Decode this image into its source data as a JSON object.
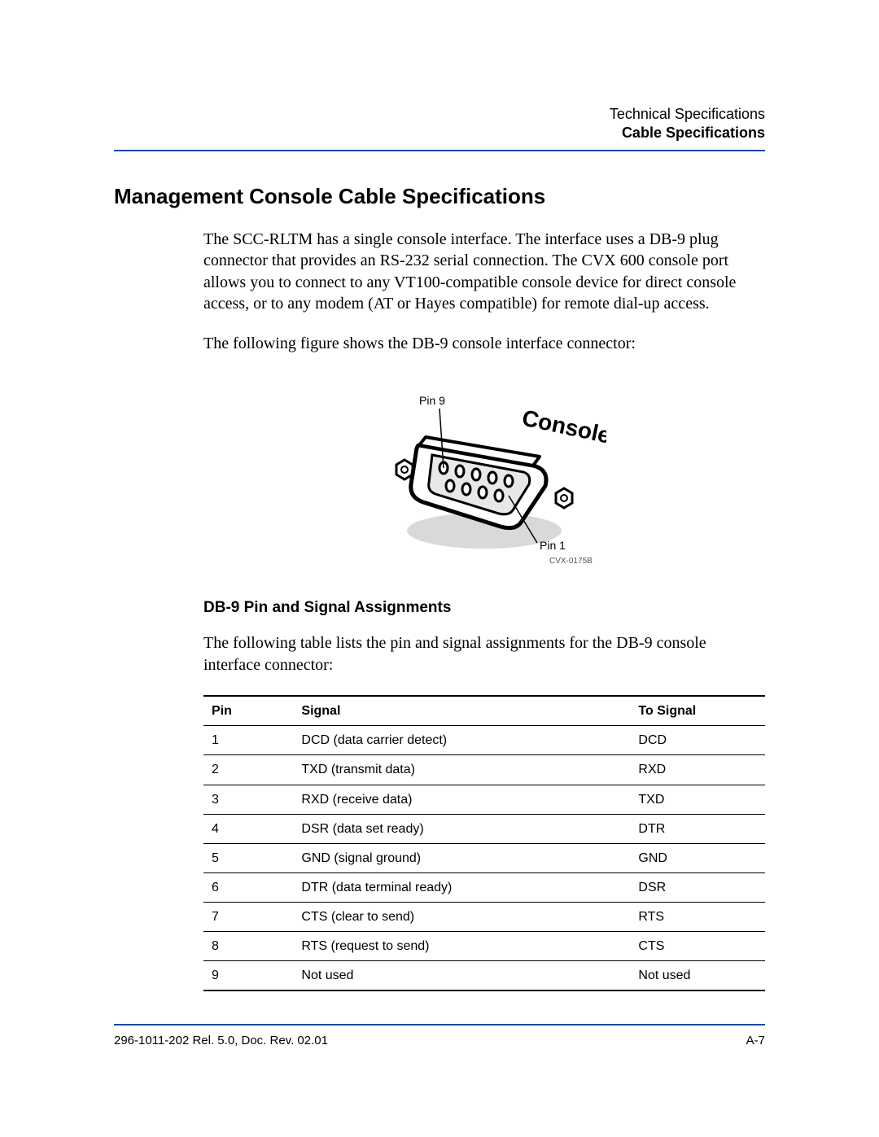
{
  "header": {
    "doc_section": "Technical Specifications",
    "subsection": "Cable Specifications"
  },
  "title": "Management Console Cable Specifications",
  "paragraphs": {
    "p1": "The SCC-RLTM has a single console interface. The interface uses a DB-9 plug connector that provides an RS-232 serial connection. The CVX 600 console port allows you to connect to any VT100-compatible console device for direct console access, or to any modem (AT or Hayes compatible) for remote dial-up access.",
    "p2": "The following figure shows the DB-9 console interface connector:"
  },
  "figure": {
    "label_top": "Pin 9",
    "label_main": "Console",
    "label_bottom": "Pin 1",
    "code": "CVX-0175B"
  },
  "subsection_title": "DB-9 Pin and Signal Assignments",
  "subsection_intro": "The following table lists the pin and signal assignments for the DB-9 console interface connector:",
  "table": {
    "headers": {
      "pin": "Pin",
      "signal": "Signal",
      "to_signal": "To Signal"
    },
    "rows": [
      {
        "pin": "1",
        "signal": "DCD (data carrier detect)",
        "to_signal": "DCD"
      },
      {
        "pin": "2",
        "signal": "TXD (transmit data)",
        "to_signal": "RXD"
      },
      {
        "pin": "3",
        "signal": "RXD (receive data)",
        "to_signal": "TXD"
      },
      {
        "pin": "4",
        "signal": "DSR (data set ready)",
        "to_signal": "DTR"
      },
      {
        "pin": "5",
        "signal": "GND (signal ground)",
        "to_signal": "GND"
      },
      {
        "pin": "6",
        "signal": "DTR (data terminal ready)",
        "to_signal": "DSR"
      },
      {
        "pin": "7",
        "signal": "CTS (clear to send)",
        "to_signal": "RTS"
      },
      {
        "pin": "8",
        "signal": "RTS (request to send)",
        "to_signal": "CTS"
      },
      {
        "pin": "9",
        "signal": "Not used",
        "to_signal": "Not used"
      }
    ]
  },
  "footer": {
    "left": "296-1011-202 Rel. 5.0, Doc. Rev. 02.01",
    "right": "A-7"
  }
}
